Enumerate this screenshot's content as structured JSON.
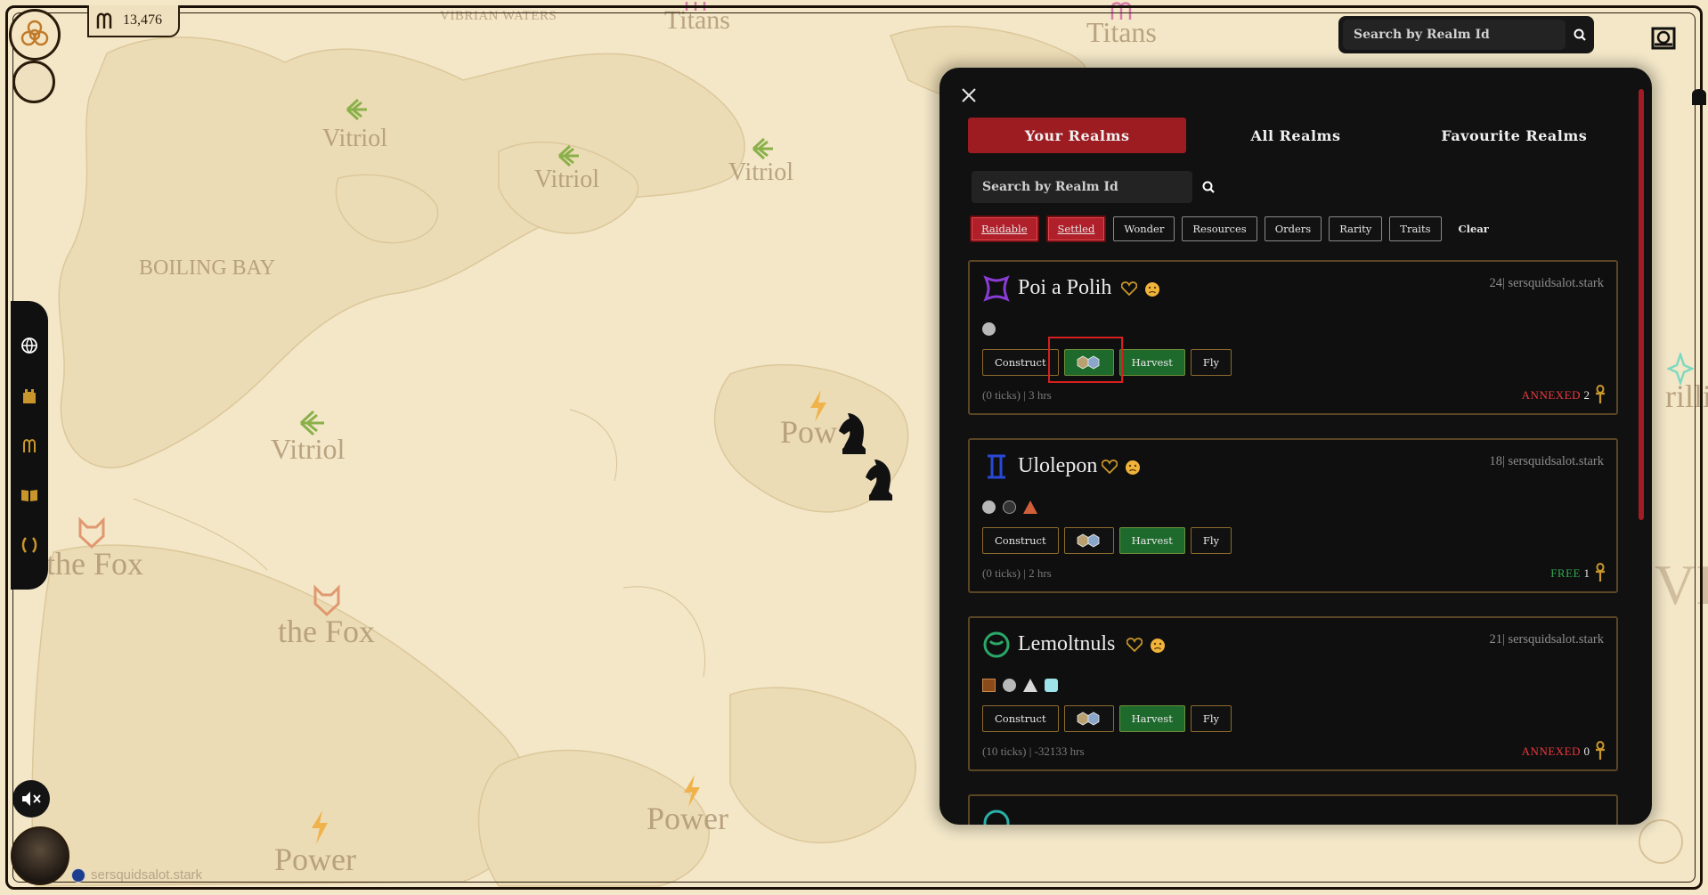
{
  "top_left": {
    "counter": "13,476"
  },
  "map_labels": {
    "vibrian": "VIBRIAN WATERS",
    "boiling": "BOILING BAY",
    "vitriol_1": "Vitriol",
    "vitriol_2": "Vitriol",
    "vitriol_3": "Vitriol",
    "vitriol_4": "Vitriol",
    "titans_1": "Titans",
    "titans_2": "Titans",
    "fox_1": "the Fox",
    "fox_2": "the Fox",
    "power_1": "Pow",
    "power_2": "Power",
    "power_3": "Power",
    "right_partial_1": "rillia",
    "right_partial_2": "VI"
  },
  "account": {
    "name": "sersquidsalot.stark"
  },
  "top_search": {
    "placeholder": "Search by Realm Id"
  },
  "panel": {
    "tabs": [
      "Your Realms",
      "All Realms",
      "Favourite Realms"
    ],
    "search_placeholder": "Search by Realm Id",
    "filters": {
      "raidable": "Raidable",
      "settled": "Settled",
      "wonder": "Wonder",
      "resources": "Resources",
      "orders": "Orders",
      "rarity": "Rarity",
      "traits": "Traits",
      "clear": "Clear"
    },
    "action_labels": {
      "construct": "Construct",
      "harvest": "Harvest",
      "fly": "Fly"
    },
    "realms": [
      {
        "name": "Poi a Polih",
        "owner": "24| sersquidsalot.stark",
        "ticks": "(0 ticks) | 3 hrs",
        "status": "ANNEXED",
        "count": "2"
      },
      {
        "name": "Ulolepon",
        "owner": "18| sersquidsalot.stark",
        "ticks": "(0 ticks) | 2 hrs",
        "status": "FREE",
        "count": "1"
      },
      {
        "name": "Lemoltnuls",
        "owner": "21| sersquidsalot.stark",
        "ticks": "(10 ticks) | -32133 hrs",
        "status": "ANNEXED",
        "count": "0"
      }
    ]
  },
  "colors": {
    "accent": "#9c1c22",
    "annexed": "#e8393f",
    "free": "#2fa84f",
    "harvest": "#1e6a2c",
    "gold": "#c8962a"
  }
}
